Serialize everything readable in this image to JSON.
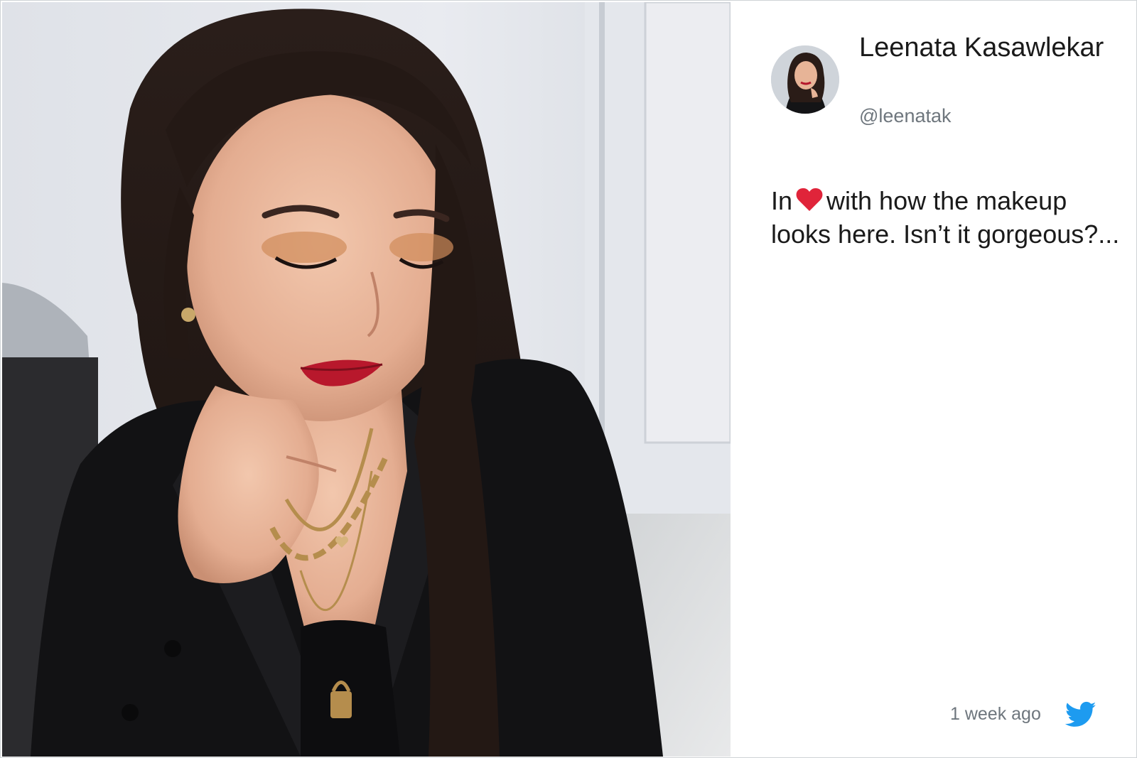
{
  "user": {
    "name": "Leenata Kasawlekar",
    "handle": "@leenatak"
  },
  "tweet": {
    "text_before": "In",
    "emoji": "heart-icon",
    "text_after": "with how the makeup looks here. Isn’t it gorgeous?...",
    "timestamp": "1 week ago"
  },
  "icons": {
    "brand": "twitter-bird-icon"
  },
  "colors": {
    "heart": "#e0243a",
    "twitter_blue": "#1d9bf0",
    "handle_grey": "#6e767d",
    "text": "#1a1a1a",
    "border": "#cfd3d6"
  }
}
